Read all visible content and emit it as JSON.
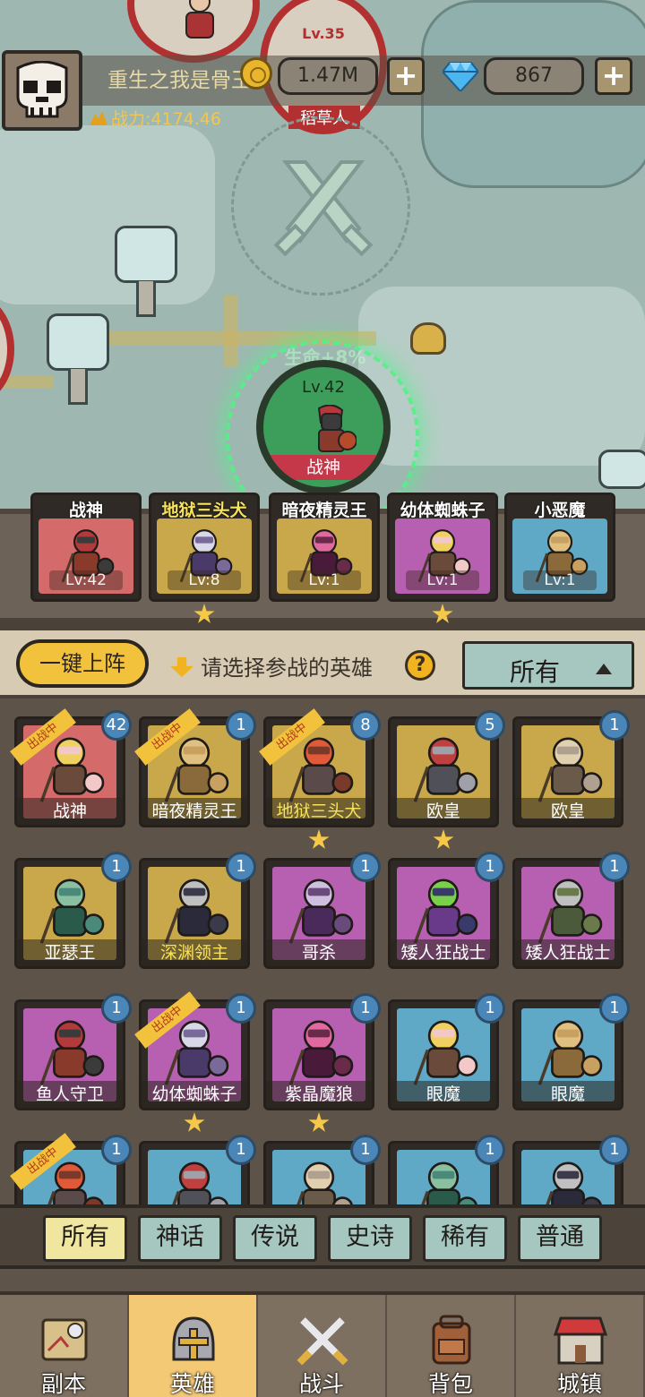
{
  "player": {
    "name": "重生之我是骨王",
    "power_label": "战力:4174.46",
    "gold": "1.47M",
    "gems": "867",
    "plus": "+"
  },
  "map": {
    "enemy_level": "Lv.35",
    "enemy_name": "稻草人",
    "current_hero_level": "Lv.42",
    "current_hero_name": "战神",
    "aura_text": "生命+8%"
  },
  "team": [
    {
      "name": "战神",
      "level": "Lv:42",
      "color": "#d46a6a",
      "stars": 0,
      "gold": false
    },
    {
      "name": "地狱三头犬",
      "level": "Lv:8",
      "color": "#c8a84a",
      "stars": 1,
      "gold": true
    },
    {
      "name": "暗夜精灵王",
      "level": "Lv:1",
      "color": "#c8a84a",
      "stars": 0,
      "gold": false
    },
    {
      "name": "幼体蜘蛛子",
      "level": "Lv:1",
      "color": "#b75fb0",
      "stars": 1,
      "gold": false
    },
    {
      "name": "小恶魔",
      "level": "Lv:1",
      "color": "#5fa8c6",
      "stars": 0,
      "gold": false
    }
  ],
  "controls": {
    "deploy_all": "一键上阵",
    "hint": "请选择参战的英雄",
    "help": "?",
    "filter_selected": "所有"
  },
  "heroes": [
    {
      "name": "战神",
      "count": "42",
      "color": "#d46a6a",
      "deployed": true,
      "gold": false,
      "stars": 0
    },
    {
      "name": "暗夜精灵王",
      "count": "1",
      "color": "#c8a84a",
      "deployed": true,
      "gold": false,
      "stars": 0
    },
    {
      "name": "地狱三头犬",
      "count": "8",
      "color": "#c8a84a",
      "deployed": true,
      "gold": true,
      "stars": 1
    },
    {
      "name": "欧皇",
      "count": "5",
      "color": "#c8a84a",
      "deployed": false,
      "gold": false,
      "stars": 1
    },
    {
      "name": "欧皇",
      "count": "1",
      "color": "#c8a84a",
      "deployed": false,
      "gold": false,
      "stars": 0
    },
    {
      "name": "亚瑟王",
      "count": "1",
      "color": "#c8a84a",
      "deployed": false,
      "gold": false,
      "stars": 0
    },
    {
      "name": "深渊领主",
      "count": "1",
      "color": "#c8a84a",
      "deployed": false,
      "gold": true,
      "stars": 0
    },
    {
      "name": "哥杀",
      "count": "1",
      "color": "#b75fb0",
      "deployed": false,
      "gold": false,
      "stars": 0
    },
    {
      "name": "矮人狂战士",
      "count": "1",
      "color": "#b75fb0",
      "deployed": false,
      "gold": false,
      "stars": 0
    },
    {
      "name": "矮人狂战士",
      "count": "1",
      "color": "#b75fb0",
      "deployed": false,
      "gold": false,
      "stars": 0
    },
    {
      "name": "鱼人守卫",
      "count": "1",
      "color": "#b75fb0",
      "deployed": false,
      "gold": false,
      "stars": 0
    },
    {
      "name": "幼体蜘蛛子",
      "count": "1",
      "color": "#b75fb0",
      "deployed": true,
      "gold": false,
      "stars": 1
    },
    {
      "name": "紫晶魔狼",
      "count": "1",
      "color": "#b75fb0",
      "deployed": false,
      "gold": false,
      "stars": 1
    },
    {
      "name": "眼魔",
      "count": "1",
      "color": "#5fa8c6",
      "deployed": false,
      "gold": false,
      "stars": 0
    },
    {
      "name": "眼魔",
      "count": "1",
      "color": "#5fa8c6",
      "deployed": false,
      "gold": false,
      "stars": 0
    },
    {
      "name": "",
      "count": "1",
      "color": "#5fa8c6",
      "deployed": true,
      "gold": false,
      "stars": 0
    },
    {
      "name": "",
      "count": "1",
      "color": "#5fa8c6",
      "deployed": false,
      "gold": false,
      "stars": 0
    },
    {
      "name": "",
      "count": "1",
      "color": "#5fa8c6",
      "deployed": false,
      "gold": false,
      "stars": 0
    },
    {
      "name": "",
      "count": "1",
      "color": "#5fa8c6",
      "deployed": false,
      "gold": false,
      "stars": 0
    },
    {
      "name": "",
      "count": "1",
      "color": "#5fa8c6",
      "deployed": false,
      "gold": false,
      "stars": 0
    }
  ],
  "deployed_ribbon": "出战中",
  "rarity_tabs": [
    "所有",
    "神话",
    "传说",
    "史诗",
    "稀有",
    "普通"
  ],
  "rarity_active": 0,
  "nav": [
    {
      "label": "副本",
      "icon": "map-icon"
    },
    {
      "label": "英雄",
      "icon": "helmet-icon"
    },
    {
      "label": "战斗",
      "icon": "crossed-swords-icon"
    },
    {
      "label": "背包",
      "icon": "backpack-icon"
    },
    {
      "label": "城镇",
      "icon": "shop-icon"
    }
  ],
  "nav_active": 1
}
